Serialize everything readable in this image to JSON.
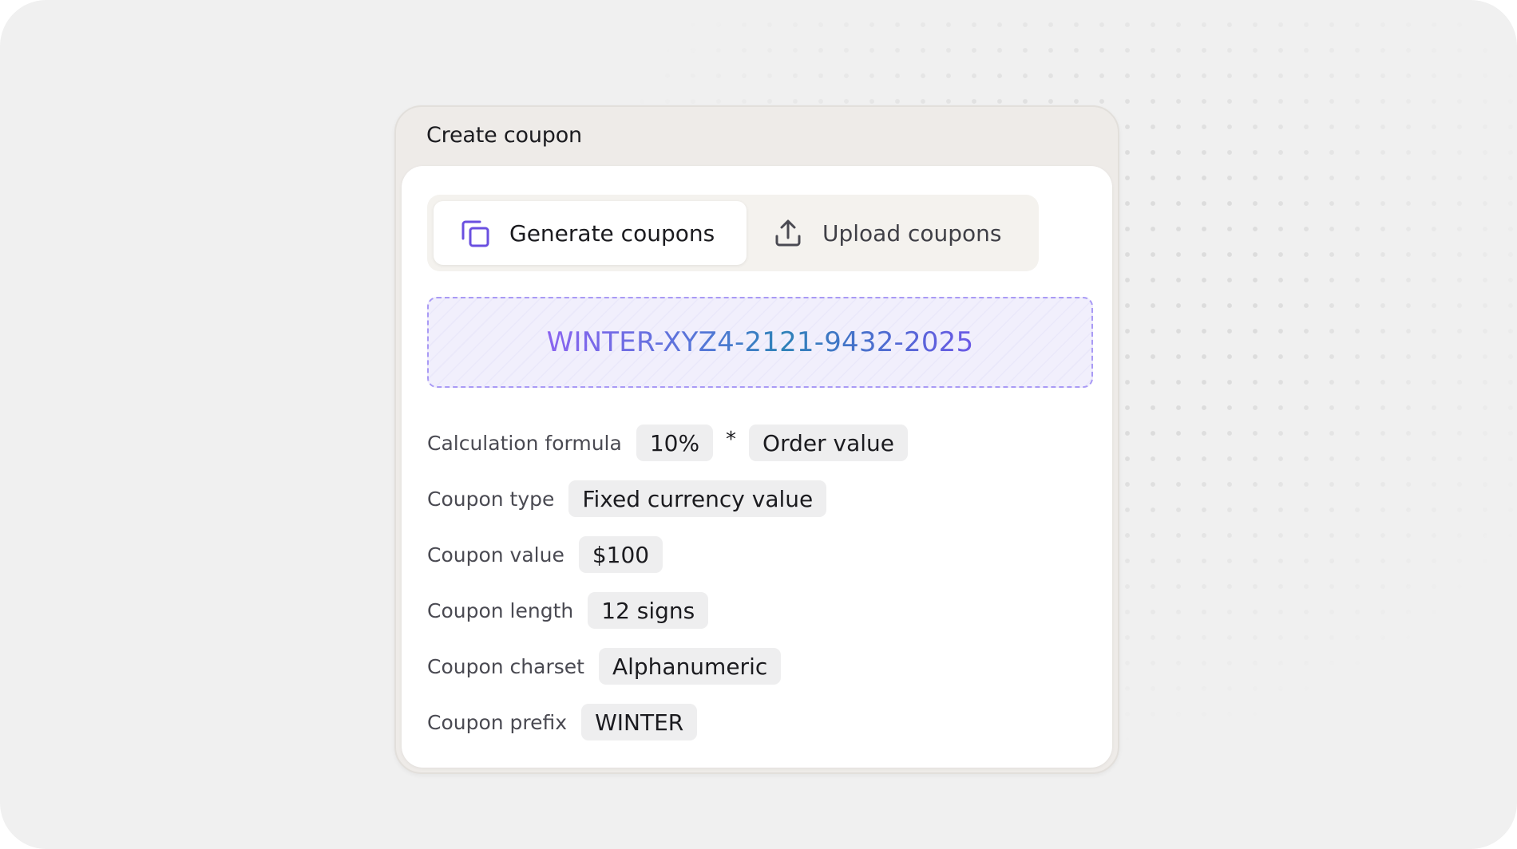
{
  "card": {
    "title": "Create coupon"
  },
  "tabs": [
    {
      "label": "Generate coupons",
      "icon": "copy-icon",
      "active": true
    },
    {
      "label": "Upload coupons",
      "icon": "upload-icon",
      "active": false
    }
  ],
  "preview": {
    "code": "WINTER-XYZ4-2121-9432-2025"
  },
  "settings": {
    "formula": {
      "label": "Calculation formula",
      "percent": "10%",
      "operator": "*",
      "base": "Order value"
    },
    "type": {
      "label": "Coupon type",
      "value": "Fixed currency value"
    },
    "value": {
      "label": "Coupon value",
      "value": "$100"
    },
    "length": {
      "label": "Coupon length",
      "value": "12 signs"
    },
    "charset": {
      "label": "Coupon charset",
      "value": "Alphanumeric"
    },
    "prefix": {
      "label": "Coupon prefix",
      "value": "WINTER"
    }
  },
  "colors": {
    "accent": "#6a4fe0",
    "background": "#f0f0f0",
    "card": "#eeebe8",
    "preview_border": "#a99af5",
    "preview_fill": "#f1effc",
    "chip": "#eeeeef"
  }
}
